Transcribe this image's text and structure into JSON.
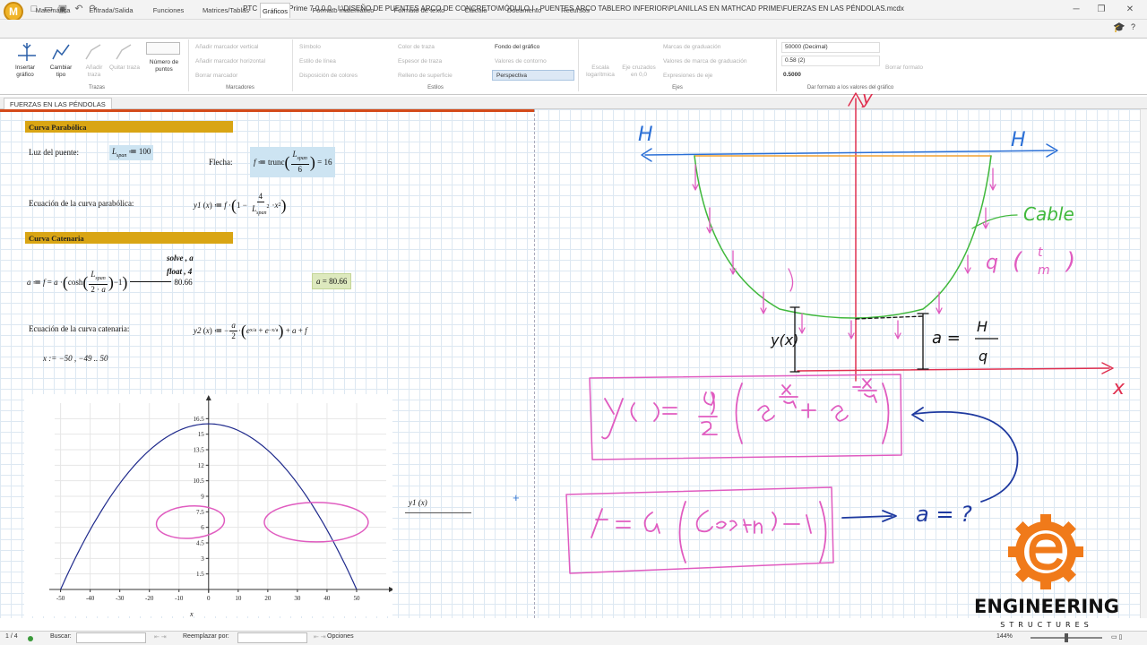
{
  "window": {
    "app_icon": "M",
    "title": "PTC Mathcad Prime 7.0.0.0 - I:\\DISEÑO DE PUENTES ARCO DE CONCRETO\\MÓDULO I - PUENTES ARCO TABLERO INFERIOR\\PLANILLAS EN MATHCAD PRIME\\FUERZAS EN LAS PÉNDOLAS.mcdx"
  },
  "tabs": [
    "Matemática",
    "Entrada/Salida",
    "Funciones",
    "Matrices/Tablas",
    "Gráficos",
    "Formato matemático",
    "Formato de texto",
    "Cálculo",
    "Documento",
    "Recursos"
  ],
  "ribbon": {
    "trazas": {
      "insert": "Insertar gráfico",
      "change": "Cambiar tipo",
      "add": "Añadir traza",
      "remove": "Quitar traza",
      "points": "Número de puntos",
      "label": "Trazas"
    },
    "marcadores": {
      "vertical": "Añadir marcador vertical",
      "horizontal": "Añadir marcador horizontal",
      "delete": "Borrar marcador",
      "label": "Marcadores"
    },
    "estilos": {
      "symbol": "Símbolo",
      "line_style": "Estilo de línea",
      "color_layout": "Disposición de colores",
      "trace_color": "Color de traza",
      "trace_width": "Espesor de traza",
      "surface_fill": "Relleno de superficie",
      "background": "Fondo del gráfico",
      "contour": "Valores de contorno",
      "perspective": "Perspectiva",
      "label": "Estilos"
    },
    "ejes": {
      "log": "Escala logarítmica",
      "cross": "Eje cruzados en 0,0",
      "tick_marks": "Marcas de graduación",
      "tick_values": "Valores de marca de graduación",
      "axis_expr": "Expresiones de eje",
      "label": "Ejes"
    },
    "formato": {
      "num_format": "50000 (Decimal)",
      "precision": "0.58 (2)",
      "sample": "0.5000",
      "clear": "Borrar formato",
      "label": "Dar formato a los valores del gráfico"
    }
  },
  "document_tab": "FUERZAS EN LAS PÉNDOLAS",
  "worksheet": {
    "sec1": "Curva Parabólica",
    "luz_label": "Luz del puente:",
    "flecha_label": "Flecha:",
    "flecha_value": "16",
    "ec_par_label": "Ecuación de la curva parabólica:",
    "sec2": "Curva Catenaria",
    "solve_kw": "solve , a",
    "float_kw": "float , 4",
    "a_value": "80.66",
    "ec_cat_label": "Ecuación de la curva catenaria:",
    "range_def": "x := −50 , −49 .. 50",
    "legend_label": "y1 (x)",
    "xaxis_label": "x"
  },
  "chart_data": {
    "type": "line",
    "series": [
      {
        "name": "y1 (x)",
        "function": "16*(1-4/100^2*x^2)",
        "x": [
          -50,
          -40,
          -30,
          -20,
          -10,
          0,
          10,
          20,
          30,
          40,
          50
        ],
        "y": [
          0,
          5.76,
          10.24,
          13.44,
          15.36,
          16,
          15.36,
          13.44,
          10.24,
          5.76,
          0
        ]
      }
    ],
    "x_ticks": [
      -50,
      -40,
      -30,
      -20,
      -10,
      0,
      10,
      20,
      30,
      40,
      50
    ],
    "y_ticks": [
      "1.5",
      "3",
      "4.5",
      "6",
      "7.5",
      "9",
      "10.5",
      "12",
      "13.5",
      "15",
      "16.5"
    ],
    "y_tick_values": [
      1.5,
      3,
      4.5,
      6,
      7.5,
      9,
      10.5,
      12,
      13.5,
      15,
      16.5
    ],
    "xlim": [
      -52,
      60
    ],
    "ylim": [
      0,
      18
    ],
    "xlabel": "x",
    "ylabel": "",
    "grid": true,
    "line_color": "#1f2a8c",
    "grid_color": "#e6e6e6"
  },
  "annotations": {
    "H_left": "H",
    "H_right": "H",
    "y_axis": "y",
    "x_axis": "x",
    "cable": "Cable",
    "q_label": "q",
    "q_unit_num": "t",
    "q_unit_den": "m",
    "yx": "y(x)",
    "a_lhs": "a =",
    "a_num": "H",
    "a_den": "q",
    "eq1": "y(x) = a?/2 (e^(x/a?) + e^(−x/a?))",
    "eq2": "f = a? (Cosh(L/2·a?) − 1)",
    "eq3": "a = ?",
    "colors": {
      "blue": "#2a6fd6",
      "red": "#e03050",
      "orange": "#f0a030",
      "green": "#40b83c",
      "magenta": "#e05cc0",
      "dark_blue": "#1f3aa0"
    }
  },
  "branding": {
    "name": "ENGINEERING",
    "sub": "STRUCTURES",
    "color": "#f07a1a"
  },
  "statusbar": {
    "page": "1 / 4",
    "search_label": "Buscar:",
    "replace_label": "Reemplazar por:",
    "options": "Opciones",
    "zoom": "144%"
  }
}
